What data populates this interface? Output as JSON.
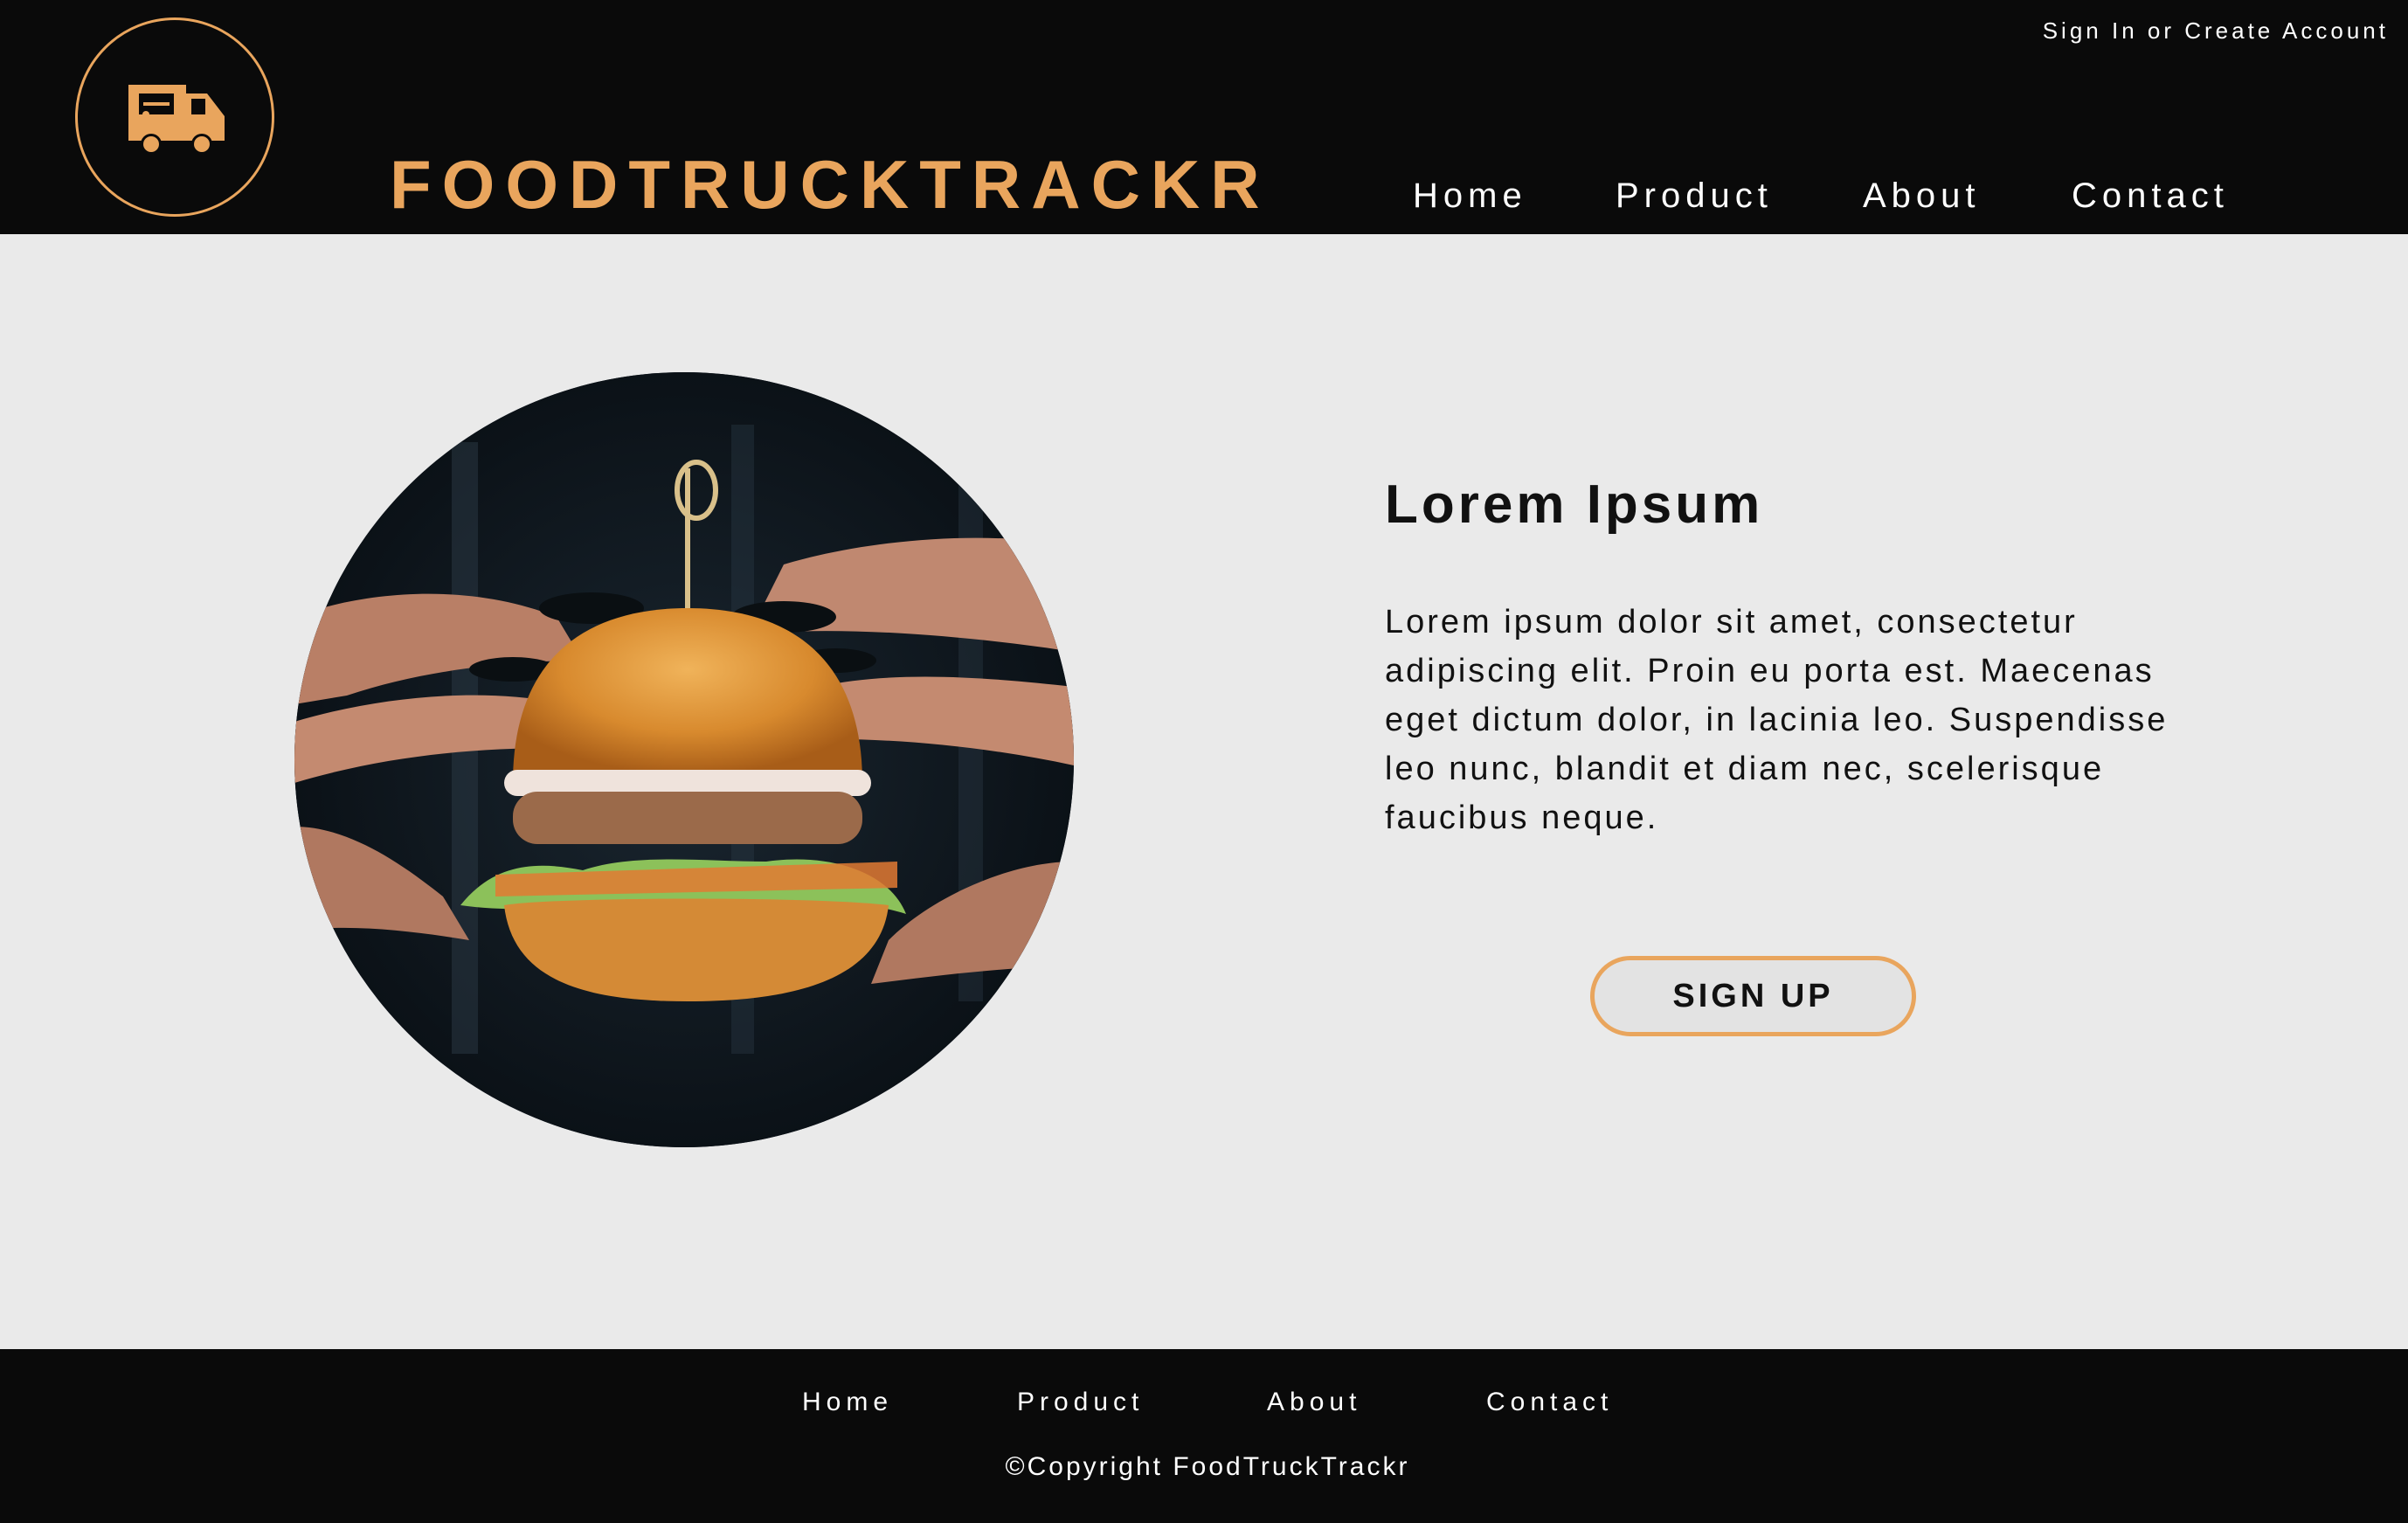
{
  "colors": {
    "accent": "#e9a55d",
    "header_bg": "#0a0a0a",
    "main_bg": "#eaeaea",
    "text_dark": "#111111"
  },
  "header": {
    "logo_icon": "food-truck-icon",
    "brand": "FOODTRUCKTRACKR",
    "account_link": "Sign In or Create Account",
    "nav": [
      "Home",
      "Product",
      "About",
      "Contact"
    ]
  },
  "hero": {
    "image": "burger-photo",
    "title": "Lorem Ipsum",
    "body": "Lorem ipsum dolor sit amet, consectetur adipiscing elit. Proin eu porta est. Maecenas eget dictum dolor, in lacinia leo. Suspendisse leo nunc, blandit et diam nec, scelerisque faucibus neque.",
    "cta": "SIGN UP"
  },
  "footer": {
    "nav": [
      "Home",
      "Product",
      "About",
      "Contact"
    ],
    "copyright": "©Copyright FoodTruckTrackr"
  }
}
